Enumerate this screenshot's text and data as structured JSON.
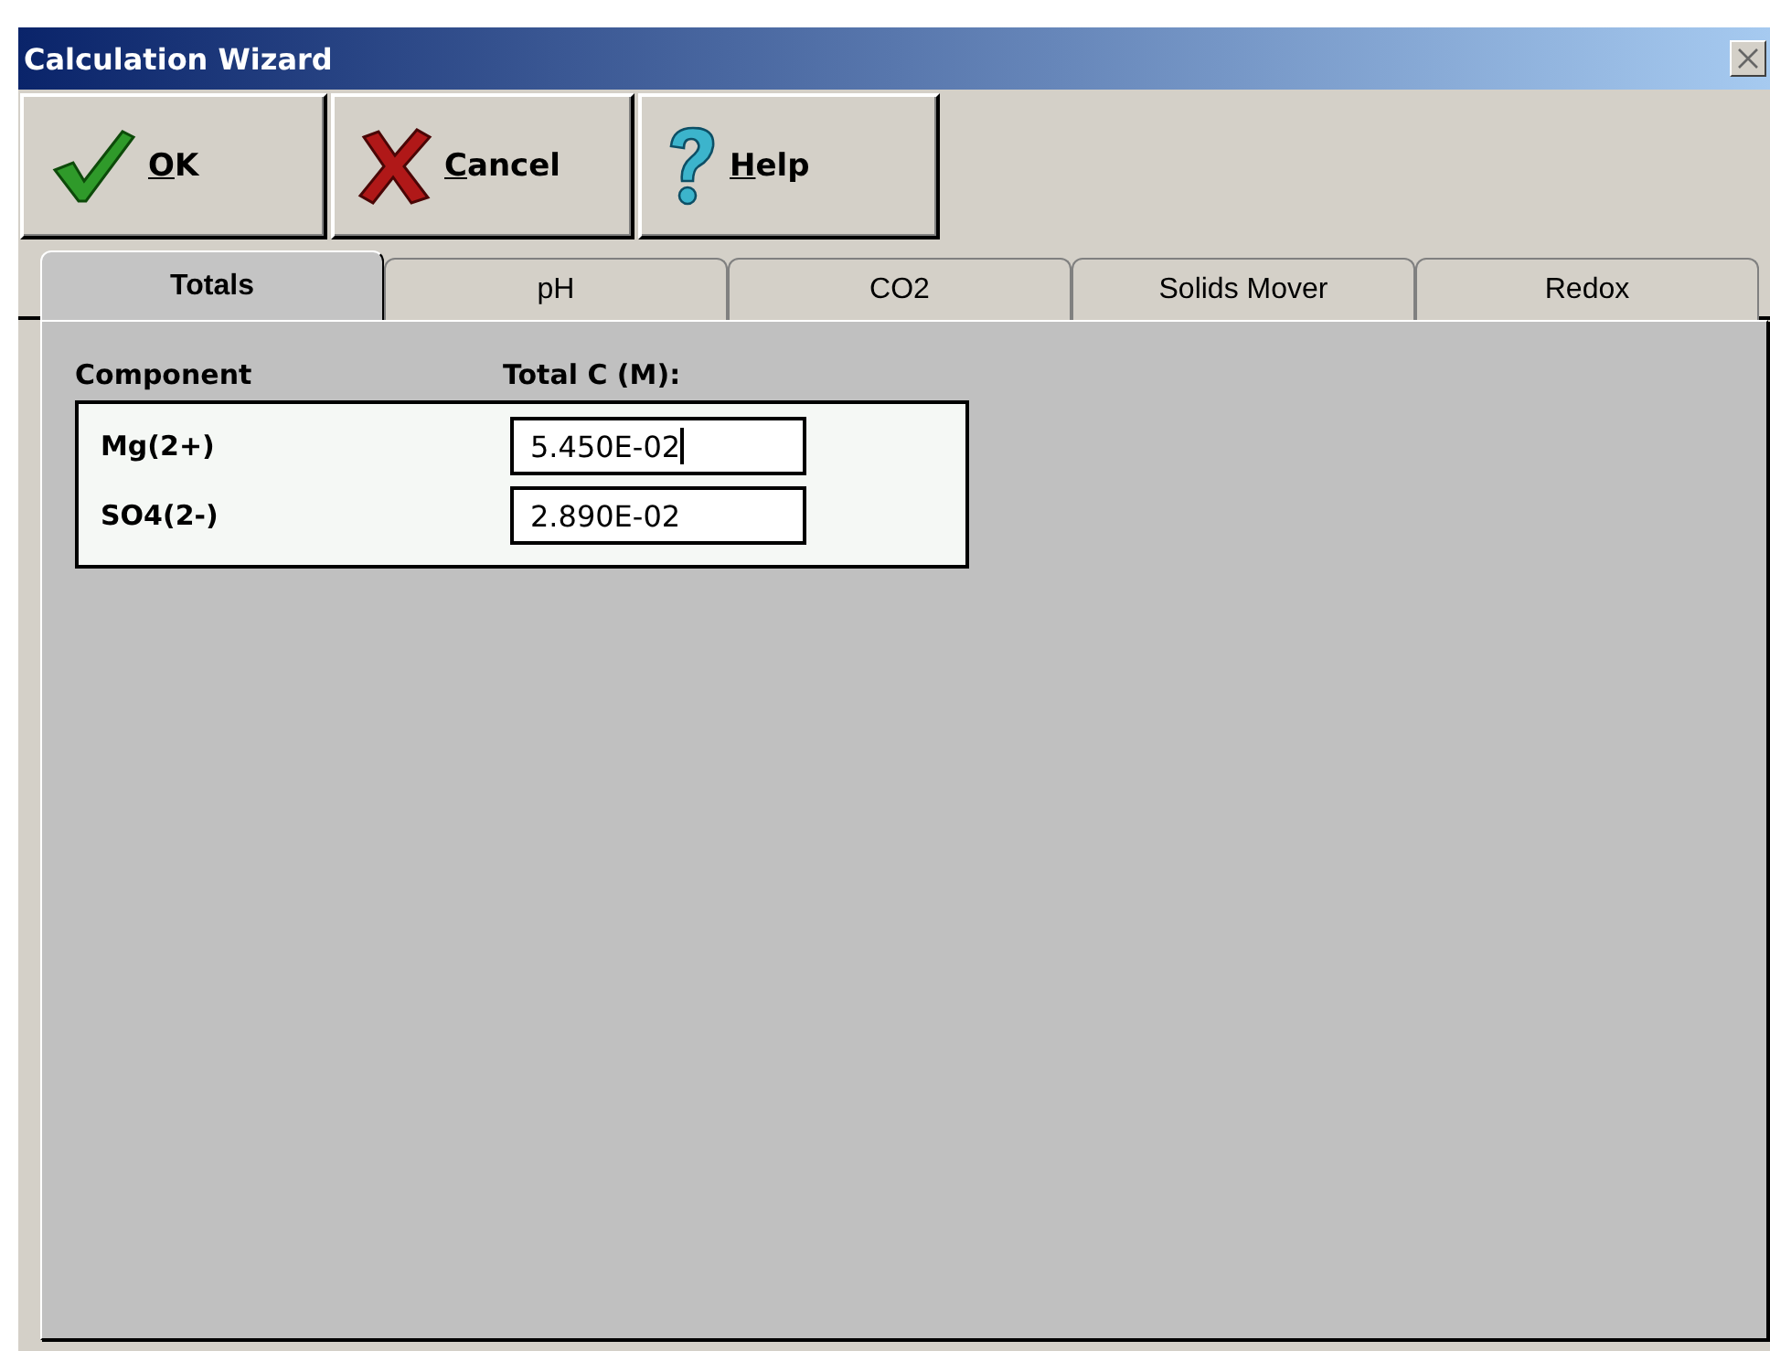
{
  "window": {
    "title": "Calculation Wizard"
  },
  "buttons": [
    {
      "kind": "ok",
      "mnemonic": "O",
      "label_rest": "K"
    },
    {
      "kind": "cancel",
      "mnemonic": "C",
      "label_rest": "ancel"
    },
    {
      "kind": "help",
      "mnemonic": "H",
      "label_rest": "elp"
    }
  ],
  "tabs": [
    {
      "label": "Totals",
      "selected": true
    },
    {
      "label": "pH",
      "selected": false
    },
    {
      "label": "CO2",
      "selected": false
    },
    {
      "label": "Solids Mover",
      "selected": false
    },
    {
      "label": "Redox",
      "selected": false
    }
  ],
  "table": {
    "columns": [
      "Component",
      "Total C (M):"
    ],
    "rows": [
      {
        "component": "Mg(2+)",
        "value": "5.450E-02",
        "focused": true
      },
      {
        "component": "SO4(2-)",
        "value": "2.890E-02",
        "focused": false
      }
    ]
  }
}
